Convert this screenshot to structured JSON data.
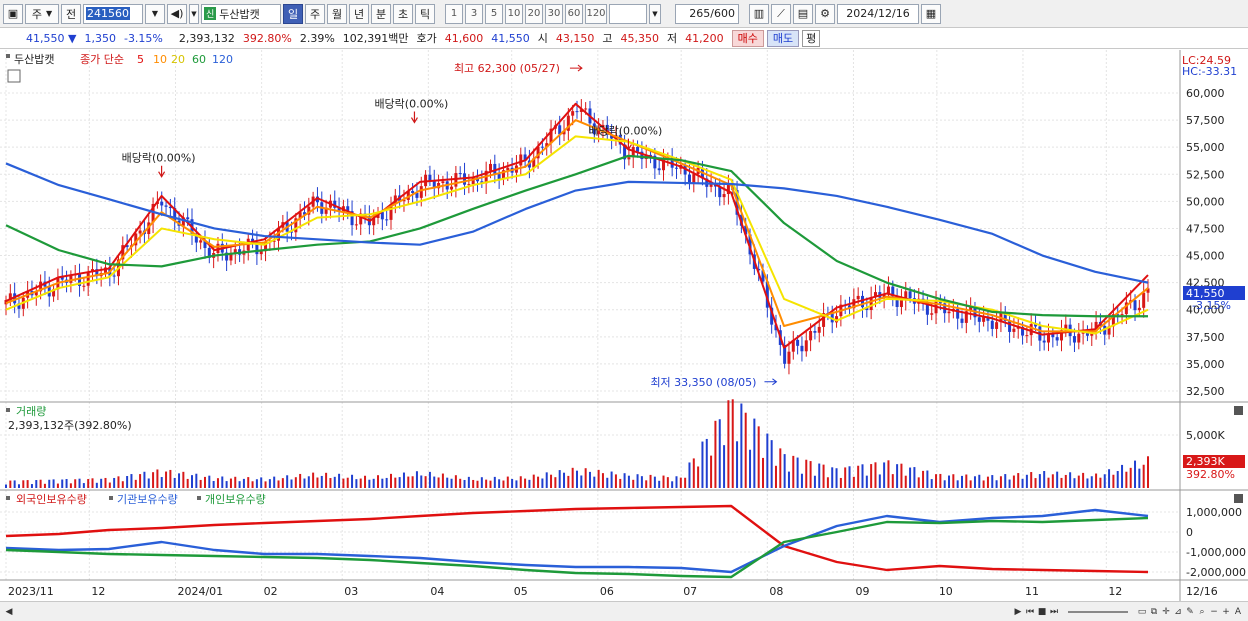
{
  "toolbar": {
    "market": "주",
    "prev": "전",
    "code": "241560",
    "stock_tag": "신",
    "stock_name": "두산밥캣",
    "periods": [
      "일",
      "주",
      "월",
      "년",
      "분",
      "초",
      "틱"
    ],
    "active_period": "일",
    "intervals": [
      "1",
      "3",
      "5",
      "10",
      "20",
      "30",
      "60",
      "120"
    ],
    "count": "265",
    "count_total": "/600",
    "date": "2024/12/16"
  },
  "info": {
    "price": "41,550",
    "arrow": "▼",
    "change": "1,350",
    "change_pct": "-3.15%",
    "volume": "2,393,132",
    "volume_ratio": "392.80%",
    "turnover": "2.39%",
    "amount": "102,391백만",
    "bid_label": "호가",
    "bid": "41,600",
    "ask": "41,550",
    "open_label": "시",
    "open": "43,150",
    "high_label": "고",
    "high": "45,350",
    "low_label": "저",
    "low": "41,200",
    "buy": "매수",
    "sell": "매도",
    "avg": "평"
  },
  "price_panel": {
    "title": "두산밥캣",
    "legend_close": "종가 단순",
    "ma_periods": [
      "5",
      "10",
      "20",
      "60",
      "120"
    ],
    "lc": "LC:24.59",
    "hc": "HC:-33.31",
    "current_price": "41,550",
    "current_pct": "-3.15%",
    "annotations": [
      {
        "text": "배당락(0.00%)",
        "date": "2023-12-27",
        "price": 52000
      },
      {
        "text": "배당락(0.00%)",
        "date": "2024-03-27",
        "price": 57000
      },
      {
        "text": "배당락(0.00%)",
        "date": "2024-06-12",
        "price": 54500
      }
    ],
    "high_note": "최고 62,300 (05/27)",
    "low_note": "최저 33,350 (08/05)",
    "y_ticks": [
      "60,000",
      "57,500",
      "55,000",
      "52,500",
      "50,000",
      "47,500",
      "45,000",
      "42,500",
      "40,000",
      "37,500",
      "35,000",
      "32,500"
    ]
  },
  "volume_panel": {
    "title": "거래량",
    "subtitle": "2,393,132주(392.80%)",
    "y_tick": "5,000K",
    "current": "2,393K",
    "current_pct": "392.80%"
  },
  "holding_panel": {
    "legend": [
      "외국인보유수량",
      "기관보유수량",
      "개인보유수량"
    ],
    "y_ticks": [
      "1,000,000",
      "0",
      "-1,000,000",
      "-2,000,000"
    ]
  },
  "x_labels": [
    "2023/11",
    "12",
    "2024/01",
    "02",
    "03",
    "04",
    "05",
    "06",
    "07",
    "08",
    "09",
    "10",
    "11",
    "12",
    "12/16"
  ],
  "colors": {
    "up": "#d81818",
    "down": "#1f3fd0",
    "ma5": "#e01010",
    "ma10": "#ff8c00",
    "ma20": "#f5e400",
    "ma60": "#1e9a3a",
    "ma120": "#2a5fd8",
    "foreign": "#e01010",
    "institution": "#2a5fd8",
    "individual": "#1e9a3a"
  },
  "chart_data": {
    "type": "line",
    "title": "두산밥캣",
    "x": [
      "2023-11-01",
      "2023-11-20",
      "2023-12-08",
      "2023-12-27",
      "2024-01-15",
      "2024-02-02",
      "2024-02-21",
      "2024-03-11",
      "2024-03-29",
      "2024-04-17",
      "2024-05-06",
      "2024-05-24",
      "2024-06-12",
      "2024-07-01",
      "2024-07-19",
      "2024-08-07",
      "2024-08-26",
      "2024-09-13",
      "2024-10-02",
      "2024-10-21",
      "2024-11-08",
      "2024-11-27",
      "2024-12-16"
    ],
    "series": [
      {
        "name": "종가",
        "values": [
          40500,
          42500,
          43500,
          50000,
          45000,
          46000,
          50000,
          48000,
          51500,
          52000,
          53500,
          58500,
          54500,
          53000,
          50500,
          35500,
          40000,
          41500,
          40000,
          39000,
          37500,
          38000,
          41550
        ]
      },
      {
        "name": "5",
        "values": [
          40800,
          43000,
          43800,
          50500,
          45500,
          46500,
          50300,
          48200,
          51800,
          52200,
          53800,
          59000,
          54800,
          53200,
          50800,
          36500,
          40200,
          41500,
          40200,
          39200,
          37700,
          38200,
          43200
        ]
      },
      {
        "name": "10",
        "values": [
          40600,
          42500,
          43400,
          49000,
          45800,
          46200,
          49500,
          48500,
          51000,
          52000,
          53200,
          57500,
          55500,
          53500,
          51500,
          38500,
          39800,
          41200,
          40500,
          39500,
          38000,
          38000,
          42000
        ]
      },
      {
        "name": "20",
        "values": [
          40000,
          42000,
          43000,
          47500,
          46500,
          46000,
          48500,
          48800,
          50000,
          51500,
          52500,
          56000,
          55500,
          53800,
          52000,
          41000,
          39000,
          41000,
          40800,
          40000,
          38500,
          37800,
          40000
        ]
      },
      {
        "name": "60",
        "values": [
          47800,
          45500,
          44200,
          44000,
          45000,
          45500,
          46000,
          46300,
          47500,
          49300,
          51000,
          52500,
          54200,
          53800,
          52800,
          48000,
          44500,
          42500,
          41000,
          39800,
          39500,
          39400,
          39400
        ]
      },
      {
        "name": "120",
        "values": [
          53500,
          51500,
          50200,
          48800,
          47500,
          46800,
          46500,
          46200,
          46000,
          47200,
          49300,
          51000,
          51800,
          51700,
          51600,
          51200,
          50500,
          49500,
          48300,
          47000,
          45000,
          43500,
          42500
        ]
      }
    ],
    "ylim": [
      32500,
      62300
    ],
    "grid": true,
    "legend": "top-left",
    "volume": [
      0.6,
      0.7,
      0.8,
      1.5,
      0.9,
      0.8,
      1.2,
      0.9,
      1.3,
      0.8,
      0.9,
      1.6,
      1.1,
      0.9,
      7.5,
      2.8,
      1.6,
      2.2,
      1.1,
      1.0,
      1.3,
      1.1,
      2.4
    ],
    "volume_unit": "M",
    "holdings": {
      "외국인보유수량": [
        -200000,
        -100000,
        100000,
        200000,
        350000,
        450000,
        550000,
        650000,
        800000,
        950000,
        1050000,
        1150000,
        1200000,
        1250000,
        1300000,
        -700000,
        -1500000,
        -1900000,
        -1700000,
        -1850000,
        -1900000,
        -1950000,
        -2000000
      ],
      "기관보유수량": [
        -800000,
        -900000,
        -850000,
        -500000,
        -900000,
        -1100000,
        -1100000,
        -1200000,
        -1300000,
        -1500000,
        -1650000,
        -1750000,
        -1750000,
        -1800000,
        -2000000,
        -700000,
        300000,
        800000,
        500000,
        700000,
        800000,
        1100000,
        800000
      ],
      "개인보유수량": [
        -900000,
        -1000000,
        -1100000,
        -1150000,
        -1200000,
        -1250000,
        -1300000,
        -1400000,
        -1550000,
        -1700000,
        -1900000,
        -2050000,
        -2100000,
        -2200000,
        -2250000,
        -500000,
        0,
        500000,
        450000,
        550000,
        500000,
        600000,
        700000
      ]
    }
  }
}
